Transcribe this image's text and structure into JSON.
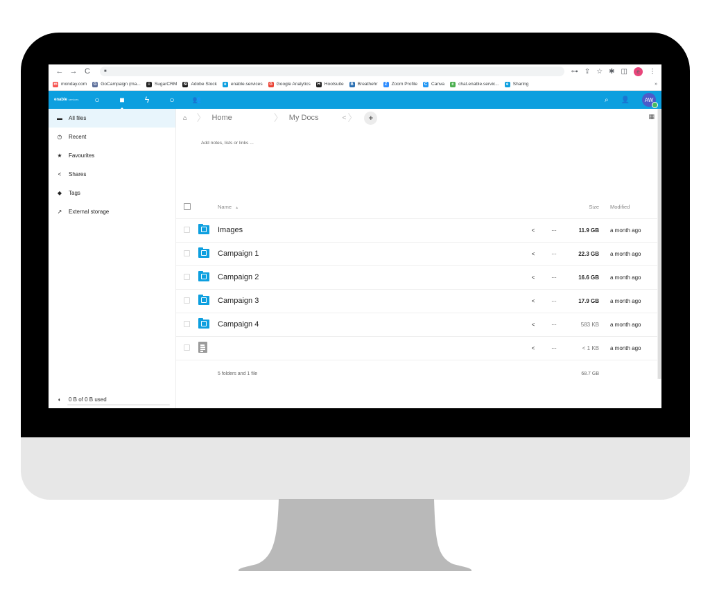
{
  "browser": {
    "nav": {
      "back": "←",
      "forward": "→",
      "reload": "C",
      "lock": "🔒"
    },
    "address": "",
    "toolbar_icons": [
      "key-icon",
      "share-icon",
      "star-icon",
      "extensions-icon",
      "side-panel-icon"
    ],
    "profile_initial": "e",
    "menu": "⋮",
    "bookmarks": [
      {
        "label": "monday.com",
        "icon_color": "#f6524f",
        "glyph": "m"
      },
      {
        "label": "GoCampaign (ma...",
        "icon_color": "#5b6e9a",
        "glyph": "G"
      },
      {
        "label": "SugarCRM",
        "icon_color": "#222222",
        "glyph": "≡"
      },
      {
        "label": "Adobe Stock",
        "icon_color": "#1c1c1c",
        "glyph": "St"
      },
      {
        "label": "enable.services",
        "icon_color": "#0d9fdf",
        "glyph": "e"
      },
      {
        "label": "Google Analytics",
        "icon_color": "#ea4335",
        "glyph": "G"
      },
      {
        "label": "Hootsuite",
        "icon_color": "#222222",
        "glyph": "H"
      },
      {
        "label": "Breathehr",
        "icon_color": "#2a6fb2",
        "glyph": "B"
      },
      {
        "label": "Zoom Profile",
        "icon_color": "#2d8cff",
        "glyph": "Z"
      },
      {
        "label": "Canva",
        "icon_color": "#2196f3",
        "glyph": "C"
      },
      {
        "label": "chat.enable.servic...",
        "icon_color": "#4caf50",
        "glyph": "c"
      },
      {
        "label": "Sharing",
        "icon_color": "#0d9fdf",
        "glyph": "e"
      }
    ],
    "bookmarks_more": "»"
  },
  "app": {
    "brand": "enable",
    "brand_sub": "services",
    "accent": "#0d9fdf",
    "nav": [
      {
        "name": "dashboard",
        "glyph": "○"
      },
      {
        "name": "files",
        "glyph": "▬",
        "active": true
      },
      {
        "name": "activity",
        "glyph": "ϟ"
      },
      {
        "name": "search-app",
        "glyph": "○"
      },
      {
        "name": "contacts",
        "glyph": "👥"
      }
    ],
    "header_right": {
      "search": "⌕",
      "contacts": "👤",
      "avatar_initials": "AW"
    }
  },
  "sidebar": {
    "items": [
      {
        "label": "All files",
        "icon": "▮",
        "active": true
      },
      {
        "label": "Recent",
        "icon": "◷"
      },
      {
        "label": "Favourites",
        "icon": "★"
      },
      {
        "label": "Shares",
        "icon": "<"
      },
      {
        "label": "Tags",
        "icon": "◆"
      },
      {
        "label": "External storage",
        "icon": "↗"
      }
    ],
    "quota": {
      "label": "0 B of 0 B used",
      "icon": "◐",
      "used_fraction": 0
    }
  },
  "breadcrumb": {
    "home_icon": "⌂",
    "items": [
      "Home",
      "My Docs"
    ],
    "share_icon": "<",
    "add": "+"
  },
  "view_toggle": "▦",
  "notes_placeholder": "Add notes, lists or links ...",
  "table": {
    "headers": {
      "name": "Name",
      "sort_indicator": "▴",
      "size": "Size",
      "modified": "Modified"
    },
    "rows": [
      {
        "name": "Images",
        "type": "folder",
        "size": "11.9 GB",
        "modified": "a month ago",
        "heavy": true
      },
      {
        "name": "Campaign 1",
        "type": "folder",
        "size": "22.3 GB",
        "modified": "a month ago",
        "heavy": true
      },
      {
        "name": "Campaign 2",
        "type": "folder",
        "size": "16.6 GB",
        "modified": "a month ago",
        "heavy": true
      },
      {
        "name": "Campaign 3",
        "type": "folder",
        "size": "17.9 GB",
        "modified": "a month ago",
        "heavy": true
      },
      {
        "name": "Campaign 4",
        "type": "folder",
        "size": "583 KB",
        "modified": "a month ago",
        "heavy": false
      },
      {
        "name": "",
        "type": "file",
        "size": "< 1 KB",
        "modified": "a month ago",
        "heavy": false
      }
    ],
    "row_actions": {
      "share": "<",
      "more": "···"
    },
    "summary": {
      "label": "5 folders and 1 file",
      "total_size": "68.7 GB"
    }
  }
}
